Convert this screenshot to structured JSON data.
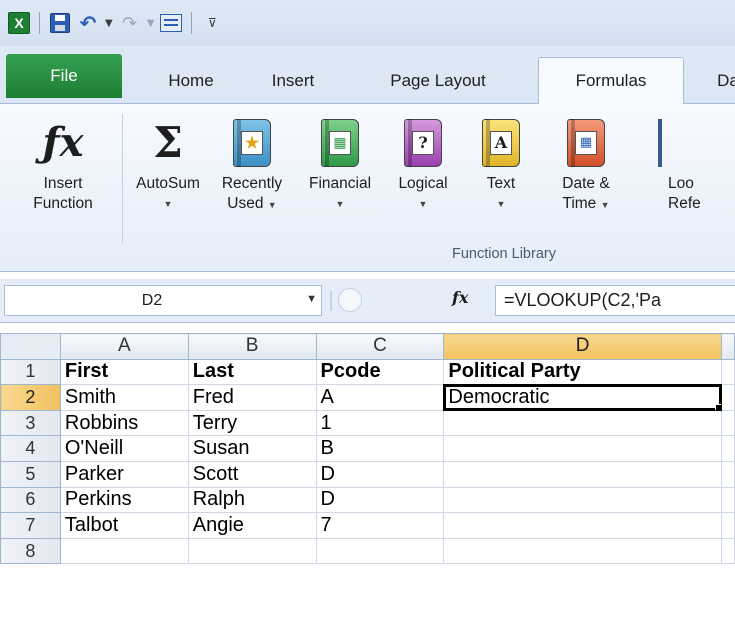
{
  "quick_access": {
    "icons": [
      "excel-logo-icon",
      "save-icon",
      "undo-icon",
      "redo-icon",
      "form-icon",
      "customize-icon"
    ]
  },
  "ribbon_tabs": [
    "File",
    "Home",
    "Insert",
    "Page Layout",
    "Formulas",
    "Da"
  ],
  "active_tab": "Formulas",
  "ribbon": {
    "buttons": [
      {
        "line1": "Insert",
        "line2": "Function",
        "icon": "insert-function-icon"
      },
      {
        "line1": "AutoSum",
        "line2": "",
        "icon": "autosum-icon"
      },
      {
        "line1": "Recently",
        "line2": "Used",
        "icon": "recently-used-book-icon"
      },
      {
        "line1": "Financial",
        "line2": "",
        "icon": "financial-book-icon"
      },
      {
        "line1": "Logical",
        "line2": "",
        "icon": "logical-book-icon"
      },
      {
        "line1": "Text",
        "line2": "",
        "icon": "text-book-icon"
      },
      {
        "line1": "Date &",
        "line2": "Time",
        "icon": "date-time-book-icon"
      },
      {
        "line1": "Loo",
        "line2": "Refe",
        "icon": "lookup-reference-icon"
      }
    ],
    "group_label": "Function Library"
  },
  "formula_bar": {
    "name_box": "D2",
    "fx_label": "fx",
    "formula": "=VLOOKUP(C2,'Pa"
  },
  "sheet": {
    "columns": [
      "A",
      "B",
      "C",
      "D"
    ],
    "rows": [
      {
        "num": "1",
        "cells": [
          "First",
          "Last",
          "Pcode",
          "Political Party"
        ]
      },
      {
        "num": "2",
        "cells": [
          "Smith",
          "Fred",
          "A",
          "Democratic"
        ]
      },
      {
        "num": "3",
        "cells": [
          "Robbins",
          "Terry",
          "1",
          ""
        ]
      },
      {
        "num": "4",
        "cells": [
          "O'Neill",
          "Susan",
          "B",
          ""
        ]
      },
      {
        "num": "5",
        "cells": [
          "Parker",
          "Scott",
          "D",
          ""
        ]
      },
      {
        "num": "6",
        "cells": [
          "Perkins",
          "Ralph",
          "D",
          ""
        ]
      },
      {
        "num": "7",
        "cells": [
          "Talbot",
          "Angie",
          "7",
          ""
        ]
      },
      {
        "num": "8",
        "cells": [
          "",
          "",
          "",
          ""
        ]
      }
    ],
    "selected_cell": "D2"
  },
  "colors": {
    "file_tab": "#1e7e34",
    "ribbon_bg": "#dfe9f5",
    "active_header": "#f1c15f"
  }
}
